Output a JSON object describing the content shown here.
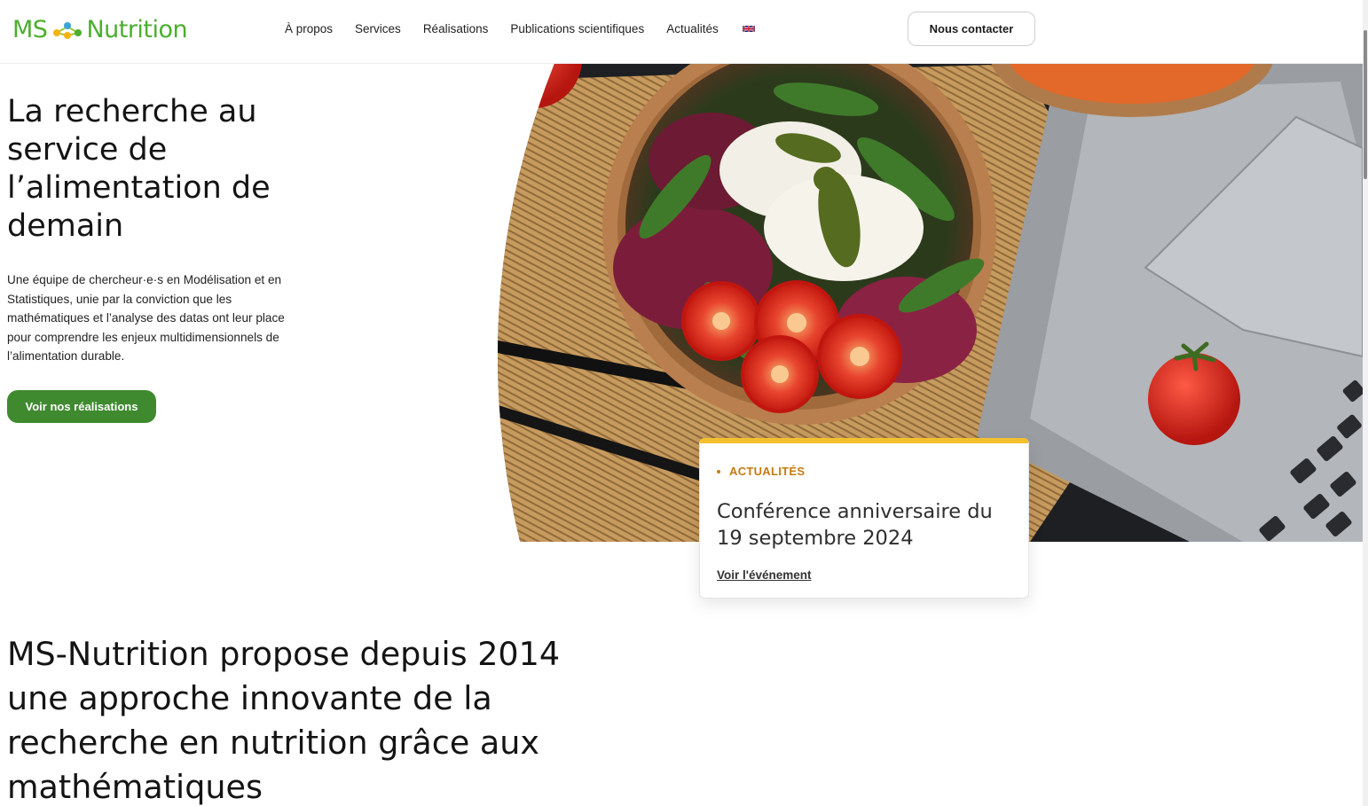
{
  "header": {
    "logo": {
      "left": "MS",
      "right": "Nutrition",
      "icon": "molecule-dots-icon"
    },
    "nav": [
      {
        "label": "À propos"
      },
      {
        "label": "Services"
      },
      {
        "label": "Réalisations"
      },
      {
        "label": "Publications scientifiques"
      },
      {
        "label": "Actualités"
      }
    ],
    "language_icon": "uk-flag-icon",
    "contact_label": "Nous contacter"
  },
  "hero": {
    "title": "La recherche au service de l’alimentation de demain",
    "description": "Une équipe de chercheur·e·s en Modélisation et en Statistiques, unie par la conviction que les mathématiques et l’analyse des datas ont leur place pour comprendre les enjeux multidimensionnels de l’alimentation durable.",
    "cta_label": "Voir nos réalisations",
    "image_subject": "salad bowl with tomatoes, mozzarella and pesto beside a laptop"
  },
  "news_card": {
    "tag": "ACTUALITÉS",
    "title": "Conférence anniversaire du 19 septembre 2024",
    "link_label": "Voir l'événement"
  },
  "intro": {
    "title": "MS-Nutrition propose depuis 2014 une approche innovante de la recherche en nutrition grâce aux mathématiques"
  },
  "colors": {
    "brand_green": "#4caf2e",
    "button_green": "#3f8a2f",
    "accent_yellow": "#f2c12e",
    "tag_orange": "#c47b13"
  }
}
